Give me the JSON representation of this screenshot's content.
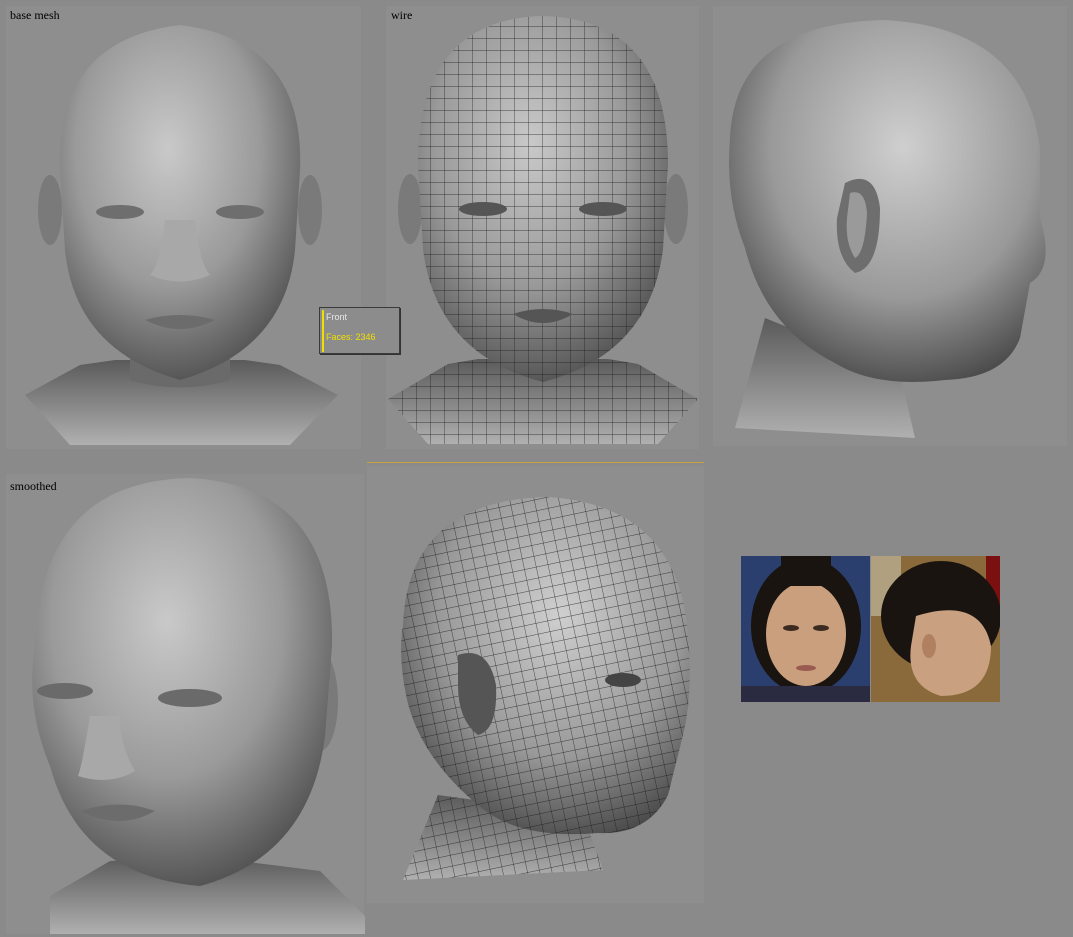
{
  "labels": {
    "base_mesh": "base mesh",
    "wire": "wire",
    "smoothed": "smoothed"
  },
  "viewport_hud": {
    "view_name": "Front",
    "faces": "Faces: 2346",
    "accent_color": "#f0e000"
  },
  "colors": {
    "background": "#8a8a8a",
    "divider": "#c8a040"
  }
}
